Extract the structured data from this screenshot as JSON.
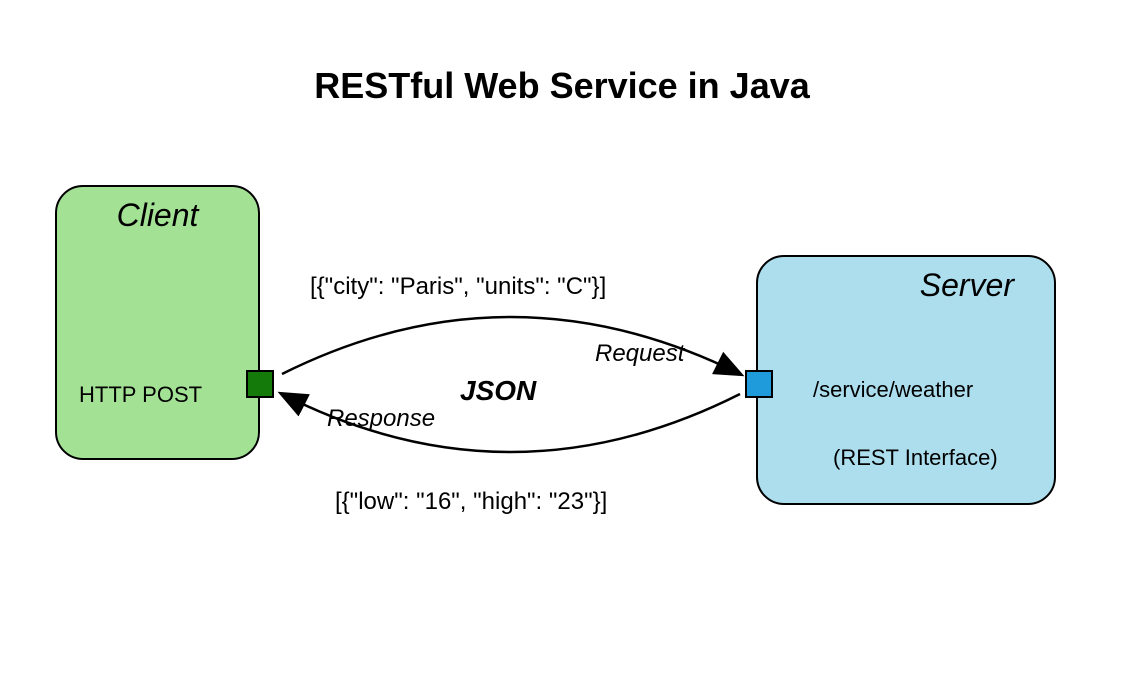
{
  "title": "RESTful Web Service in Java",
  "client": {
    "label": "Client",
    "method": "HTTP POST"
  },
  "server": {
    "label": "Server",
    "endpoint": "/service/weather",
    "interface": "(REST Interface)"
  },
  "communication": {
    "format": "JSON",
    "request": {
      "label": "Request",
      "payload": "[{\"city\": \"Paris\", \"units\": \"C\"}]"
    },
    "response": {
      "label": "Response",
      "payload": "[{\"low\": \"16\", \"high\": \"23\"}]"
    }
  }
}
